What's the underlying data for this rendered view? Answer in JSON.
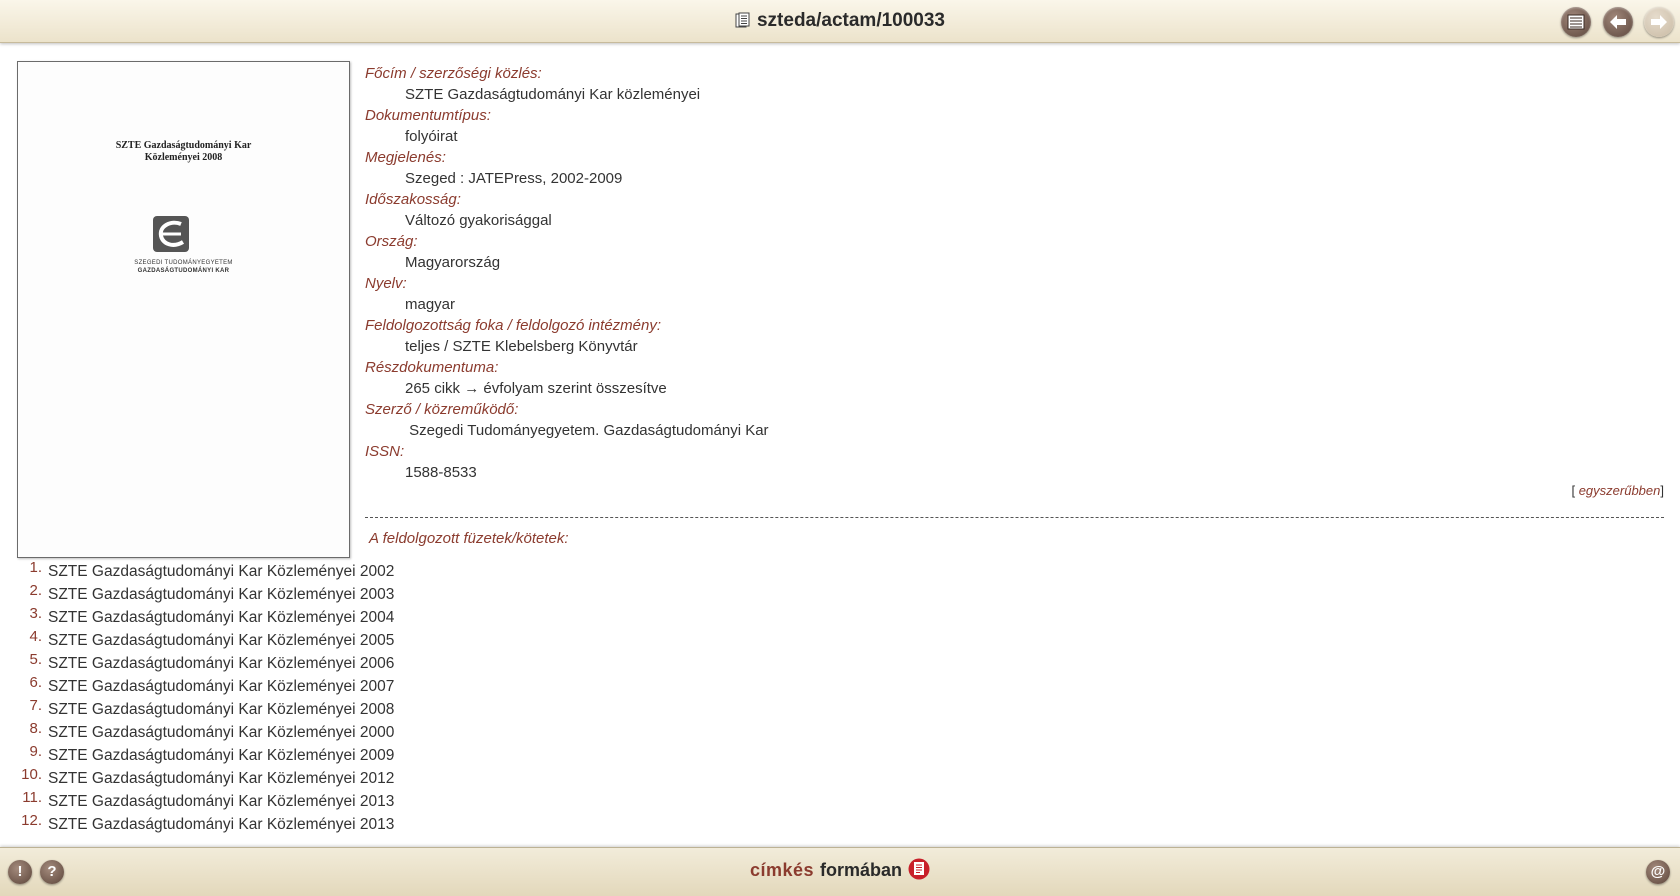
{
  "header": {
    "title": "szteda/actam/100033",
    "title_icon": "document-icon",
    "buttons": [
      {
        "name": "list-view",
        "icon": "list-icon"
      },
      {
        "name": "back",
        "icon": "arrow-left-icon"
      },
      {
        "name": "forward",
        "icon": "arrow-right-icon"
      }
    ]
  },
  "cover": {
    "title_line1": "SZTE Gazdaságtudományi Kar",
    "title_line2": "Közleményei 2008",
    "univ_line1": "SZEGEDI TUDOMÁNYEGYETEM",
    "univ_line2": "GAZDASÁGTUDOMÁNYI KAR"
  },
  "fields": [
    {
      "label": "Főcím / szerzőségi közlés:",
      "value": "SZTE Gazdaságtudományi Kar közleményei"
    },
    {
      "label": "Dokumentumtípus:",
      "value": "folyóirat"
    },
    {
      "label": "Megjelenés:",
      "value": "Szeged : JATEPress, 2002-2009"
    },
    {
      "label": "Időszakosság:",
      "value": "Változó gyakorisággal"
    },
    {
      "label": "Ország:",
      "value": "Magyarország"
    },
    {
      "label": "Nyelv:",
      "value": "magyar"
    },
    {
      "label": "Feldolgozottság foka / feldolgozó intézmény:",
      "value": "teljes / SZTE Klebelsberg Könyvtár"
    },
    {
      "label": "Részdokumentuma:",
      "value": "265 cikk → évfolyam szerint összesítve"
    },
    {
      "label": "Szerző / közreműködő:",
      "value": " Szegedi Tudományegyetem. Gazdaságtudományi Kar"
    },
    {
      "label": "ISSN:",
      "value": "1588-8533"
    }
  ],
  "simpler": {
    "open": "[",
    "link": "egyszerűbben",
    "close": "]"
  },
  "volumes_heading": "A feldolgozott füzetek/kötetek:",
  "volumes": [
    {
      "num": "1.",
      "title": "SZTE Gazdaságtudományi Kar Közleményei 2002"
    },
    {
      "num": "2.",
      "title": "SZTE Gazdaságtudományi Kar Közleményei 2003"
    },
    {
      "num": "3.",
      "title": "SZTE Gazdaságtudományi Kar Közleményei 2004"
    },
    {
      "num": "4.",
      "title": "SZTE Gazdaságtudományi Kar Közleményei 2005"
    },
    {
      "num": "5.",
      "title": "SZTE Gazdaságtudományi Kar Közleményei 2006"
    },
    {
      "num": "6.",
      "title": "SZTE Gazdaságtudományi Kar Közleményei 2007"
    },
    {
      "num": "7.",
      "title": "SZTE Gazdaságtudományi Kar Közleményei 2008"
    },
    {
      "num": "8.",
      "title": "SZTE Gazdaságtudományi Kar Közleményei 2000"
    },
    {
      "num": "9.",
      "title": "SZTE Gazdaságtudományi Kar Közleményei 2009"
    },
    {
      "num": "10.",
      "title": "SZTE Gazdaságtudományi Kar Közleményei 2012"
    },
    {
      "num": "11.",
      "title": "SZTE Gazdaságtudományi Kar Közleményei 2013"
    },
    {
      "num": "12.",
      "title": "SZTE Gazdaságtudományi Kar Közleményei 2013"
    }
  ],
  "footer": {
    "labeled": "címkés",
    "format": "formában",
    "left_buttons": [
      {
        "name": "report",
        "icon": "exclamation-icon",
        "glyph": "!"
      },
      {
        "name": "help",
        "icon": "question-icon",
        "glyph": "?"
      }
    ],
    "right_button": {
      "name": "email",
      "icon": "at-icon",
      "glyph": "@"
    }
  },
  "colors": {
    "label_red": "#8b3b2e",
    "bar_beige": "#ece3cb",
    "button_brown": "#5c463c"
  }
}
